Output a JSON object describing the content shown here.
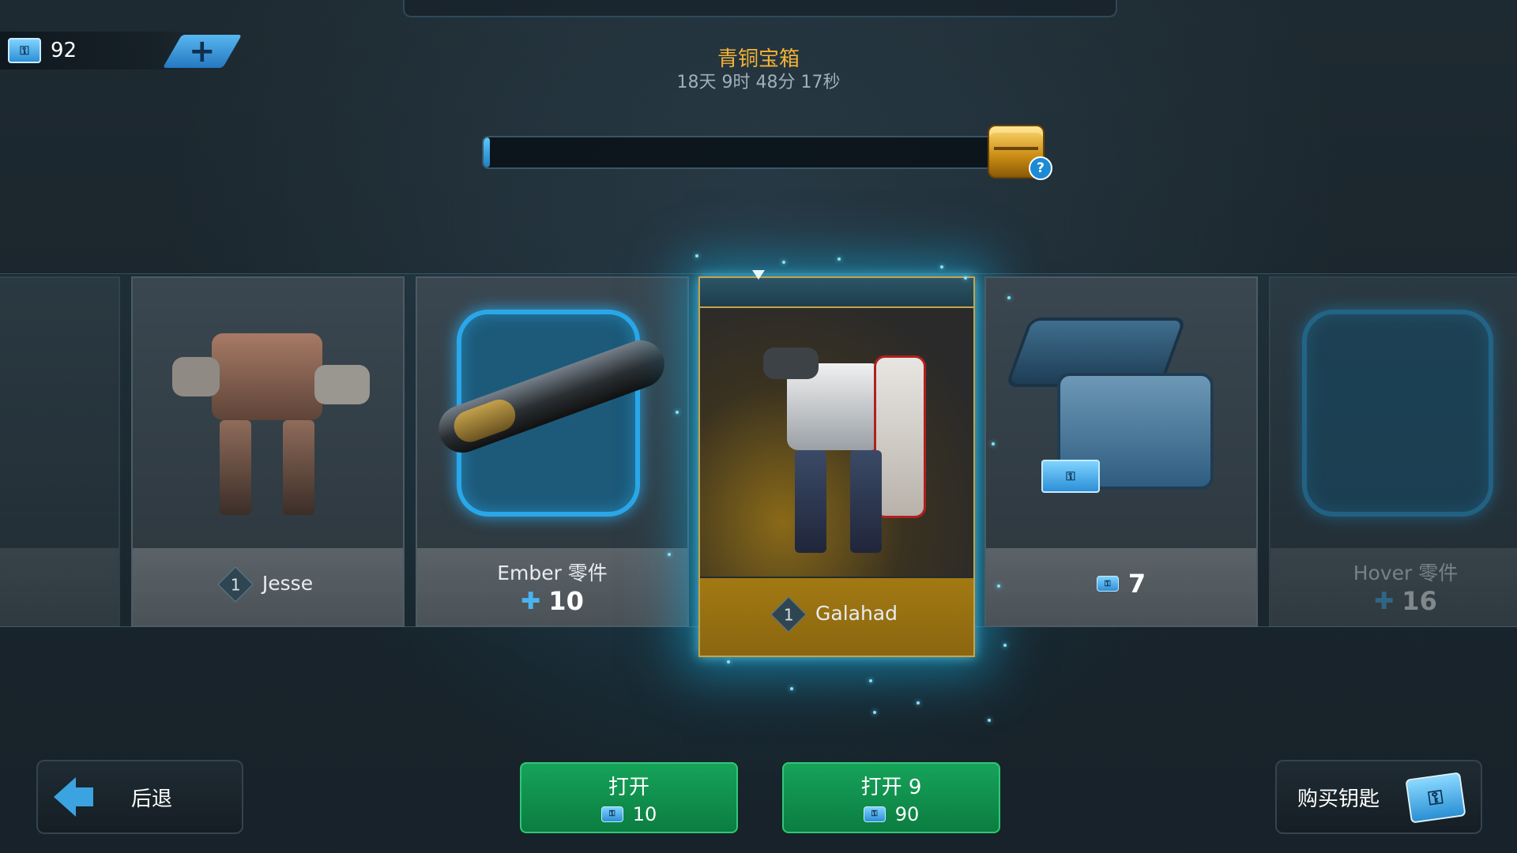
{
  "currency": {
    "icon": "key-icon",
    "count": "92",
    "add_icon": "plus-icon"
  },
  "chest": {
    "title": "青铜宝箱",
    "timer": "18天 9时 48分 17秒",
    "progress": 0.01,
    "chest_icon": "gold-chest-icon",
    "help_label": "?"
  },
  "rewards": [
    {
      "name": "",
      "faded": true
    },
    {
      "level": "1",
      "name": "Jesse",
      "type": "robot"
    },
    {
      "name": "Ember 零件",
      "quantity": "10",
      "type": "weapon-parts"
    },
    {
      "level": "1",
      "name": "Galahad",
      "type": "robot",
      "selected": true
    },
    {
      "quantity": "7",
      "type": "keys"
    },
    {
      "name": "Hover 零件",
      "quantity": "16",
      "type": "robot-parts",
      "faded": true
    }
  ],
  "buttons": {
    "back_label": "后退",
    "open_one_label": "打开",
    "open_one_price": "10",
    "open_nine_label": "打开 9",
    "open_nine_price": "90",
    "buy_keys_label": "购买钥匙"
  },
  "colors": {
    "gold_title": "#f3b236",
    "selected_gold": "#a27912",
    "green_button": "#16a35a",
    "accent_blue": "#3aa3e0"
  }
}
